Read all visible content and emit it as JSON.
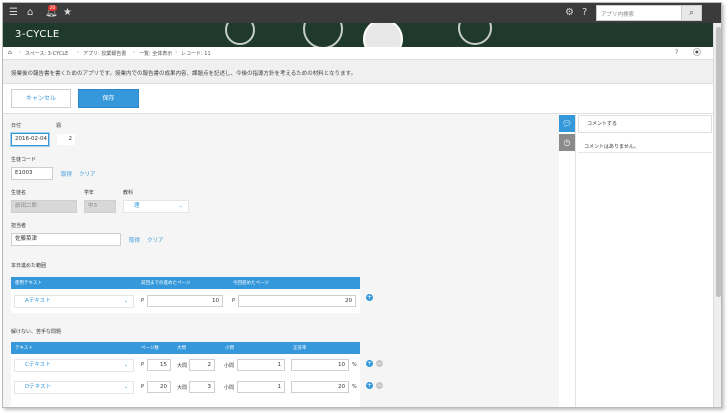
{
  "topbar": {
    "notification_count": "20",
    "search_placeholder": "アプリ内検索"
  },
  "app": {
    "title": "3-CYCLE"
  },
  "breadcrumb": {
    "items": [
      "スペース: 3-CYCLE",
      "アプリ: 授業報告書",
      "一覧: 全体表示",
      "レコード: 11"
    ]
  },
  "description": "授業後の報告書を書くためのアプリです。授業内での報告書の成果内容、課題点を記述し、今後の指導方針を考えるための材料となります。",
  "actions": {
    "cancel_label": "キャンセル",
    "save_label": "保存"
  },
  "form": {
    "date": {
      "label": "日付",
      "value": "2016-02-04"
    },
    "week": {
      "label": "週",
      "value": "2"
    },
    "student_code": {
      "label": "生徒コード",
      "value": "E1003",
      "get_label": "取得",
      "clear_label": "クリア"
    },
    "student_name": {
      "label": "生徒名",
      "value": "前田二郎"
    },
    "grade": {
      "label": "学年",
      "value": "中3"
    },
    "subject": {
      "label": "教科",
      "value": "理"
    },
    "teacher": {
      "label": "担当者",
      "value": "佐藤菜津",
      "get_label": "取得",
      "clear_label": "クリア"
    },
    "range_section": {
      "label": "本日進めた範囲",
      "headers": [
        "使用テキスト",
        "前回までの進めたページ",
        "今回進めたページ"
      ],
      "rows": [
        {
          "text": "Aテキスト",
          "prev_prefix": "P",
          "prev_page": "10",
          "cur_prefix": "P",
          "cur_page": "20"
        }
      ]
    },
    "problems_section": {
      "label": "解けない、苦手な問題",
      "headers": [
        "テキスト",
        "ページ数",
        "大問",
        "小問",
        "正答率"
      ],
      "rows": [
        {
          "text": "Cテキスト",
          "page_prefix": "P",
          "page": "15",
          "big_label": "大問",
          "big": "2",
          "small_label": "小問",
          "small": "1",
          "rate": "10",
          "unit": "%"
        },
        {
          "text": "Dテキスト",
          "page_prefix": "P",
          "page": "20",
          "big_label": "大問",
          "big": "3",
          "small_label": "小問",
          "small": "1",
          "rate": "20",
          "unit": "%"
        }
      ]
    }
  },
  "sidebar": {
    "comment_placeholder": "コメントする",
    "no_comments": "コメントはありません。"
  },
  "colors": {
    "accent": "#3498db",
    "topbar": "#3b3b3b",
    "banner": "#1f3a2c"
  }
}
